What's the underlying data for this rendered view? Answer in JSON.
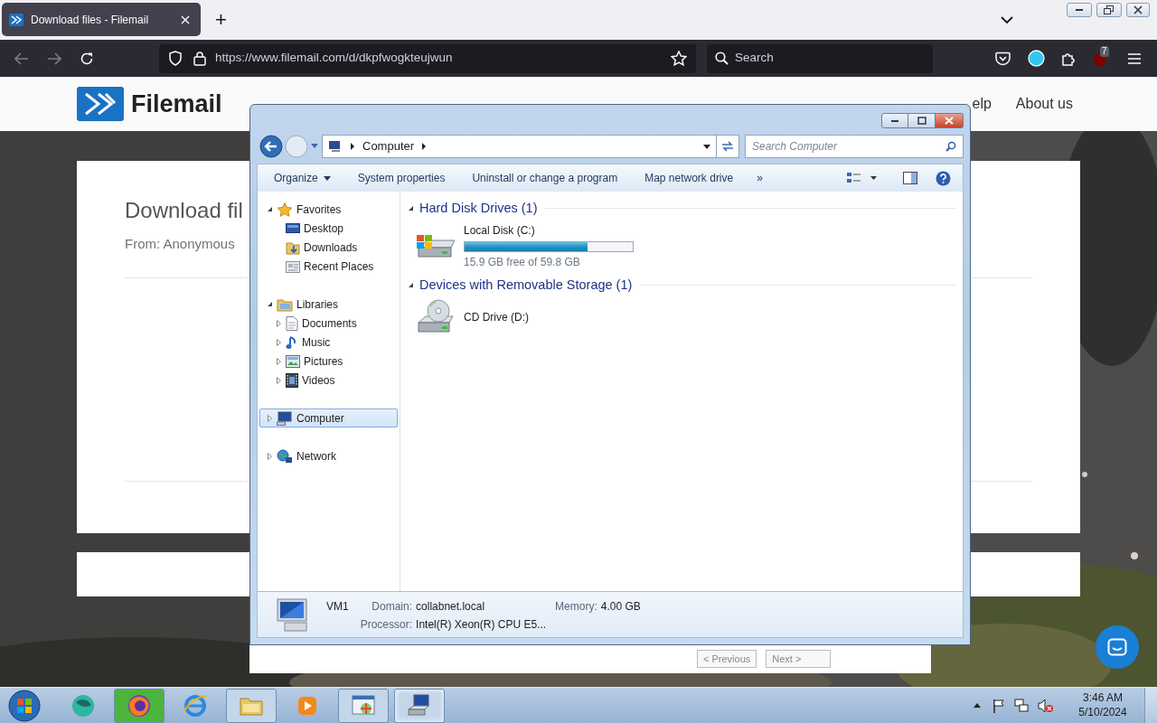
{
  "browser": {
    "tabs": [
      {
        "title": "Download files - Filemail",
        "selected": true
      }
    ],
    "new_tab": "+",
    "url": "https://www.filemail.com/d/dkpfwogkteujwun",
    "search": {
      "placeholder": "Search"
    },
    "extension_badge": "7"
  },
  "website": {
    "logo": "Filemail",
    "nav": [
      "elp",
      "About us"
    ],
    "heading": "Download fil",
    "sender": "From: Anonymous",
    "pager": [
      "< Previous",
      "Next >"
    ]
  },
  "explorer": {
    "breadcrumb": [
      "Computer"
    ],
    "search": {
      "placeholder": "Search Computer"
    },
    "commands": [
      {
        "label": "Organize",
        "dropdown": true
      },
      {
        "label": "System properties",
        "dropdown": false
      },
      {
        "label": "Uninstall or change a program",
        "dropdown": false
      },
      {
        "label": "Map network drive",
        "dropdown": false
      }
    ],
    "more": "»",
    "nav": [
      {
        "label": "Favorites",
        "kind": "star",
        "expanded": true,
        "selected": false,
        "children": [
          {
            "label": "Desktop",
            "kind": "desktop",
            "selected": false
          },
          {
            "label": "Downloads",
            "kind": "downloads",
            "selected": false
          },
          {
            "label": "Recent Places",
            "kind": "recent",
            "selected": false
          }
        ]
      },
      {
        "label": "Libraries",
        "kind": "libraries",
        "expanded": true,
        "selected": false,
        "children": [
          {
            "label": "Documents",
            "kind": "documents",
            "expanded": false,
            "selected": false
          },
          {
            "label": "Music",
            "kind": "music",
            "expanded": false,
            "selected": false
          },
          {
            "label": "Pictures",
            "kind": "pictures",
            "expanded": false,
            "selected": false
          },
          {
            "label": "Videos",
            "kind": "videos",
            "expanded": false,
            "selected": false
          }
        ]
      },
      {
        "label": "Computer",
        "kind": "computer",
        "expanded": false,
        "selected": true
      },
      {
        "label": "Network",
        "kind": "network",
        "expanded": false,
        "selected": false
      }
    ],
    "groups": [
      {
        "title": "Hard Disk Drives (1)",
        "expanded": true,
        "items": [
          {
            "kind": "hdd",
            "name": "Local Disk (C:)",
            "level": 0.73,
            "free": "15.9 GB free of 59.8 GB"
          }
        ]
      },
      {
        "title": "Devices with Removable Storage (1)",
        "expanded": true,
        "items": [
          {
            "kind": "cd",
            "name": "CD Drive (D:)"
          }
        ]
      }
    ],
    "details": {
      "name": "VM1",
      "fields": [
        {
          "label": "Domain:",
          "value": "collabnet.local"
        },
        {
          "label": "Memory:",
          "value": "4.00 GB"
        },
        {
          "label": "Processor:",
          "value": "Intel(R) Xeon(R) CPU E5..."
        }
      ]
    }
  },
  "taskbar": {
    "apps": [
      {
        "kind": "sphere",
        "running": false,
        "selected": false
      },
      {
        "kind": "browser",
        "running": true,
        "selected": false,
        "color": "#4cb43a"
      },
      {
        "kind": "ie",
        "running": false,
        "selected": false
      },
      {
        "kind": "folder",
        "running": true,
        "selected": false,
        "color": "#c4d6ea"
      },
      {
        "kind": "media",
        "running": false,
        "selected": false
      },
      {
        "kind": "panel",
        "running": true,
        "selected": false,
        "color": "#c4d6ea"
      },
      {
        "kind": "computer",
        "running": true,
        "selected": true,
        "color": "#c4d6ea"
      }
    ],
    "time": "3:46 AM",
    "date": "5/10/2024"
  }
}
